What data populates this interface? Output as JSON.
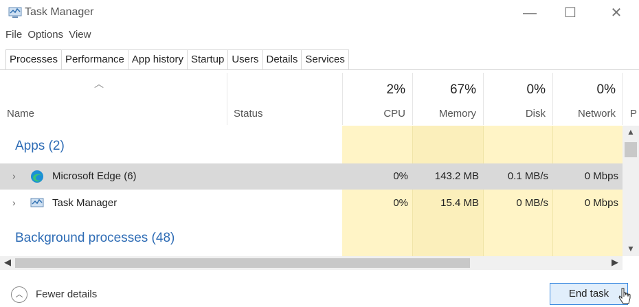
{
  "window": {
    "title": "Task Manager"
  },
  "menu": [
    "File",
    "Options",
    "View"
  ],
  "tabs": [
    "Processes",
    "Performance",
    "App history",
    "Startup",
    "Users",
    "Details",
    "Services"
  ],
  "columns": {
    "name": "Name",
    "status": "Status",
    "cpu": {
      "pct": "2%",
      "label": "CPU"
    },
    "memory": {
      "pct": "67%",
      "label": "Memory"
    },
    "disk": {
      "pct": "0%",
      "label": "Disk"
    },
    "network": {
      "pct": "0%",
      "label": "Network"
    },
    "power_partial": "P"
  },
  "groups": {
    "apps": "Apps (2)",
    "background": "Background processes (48)"
  },
  "rows": [
    {
      "name": "Microsoft Edge (6)",
      "cpu": "0%",
      "memory": "143.2 MB",
      "disk": "0.1 MB/s",
      "network": "0 Mbps"
    },
    {
      "name": "Task Manager",
      "cpu": "0%",
      "memory": "15.4 MB",
      "disk": "0 MB/s",
      "network": "0 Mbps"
    }
  ],
  "footer": {
    "fewer_details": "Fewer details",
    "end_task": "End task"
  }
}
